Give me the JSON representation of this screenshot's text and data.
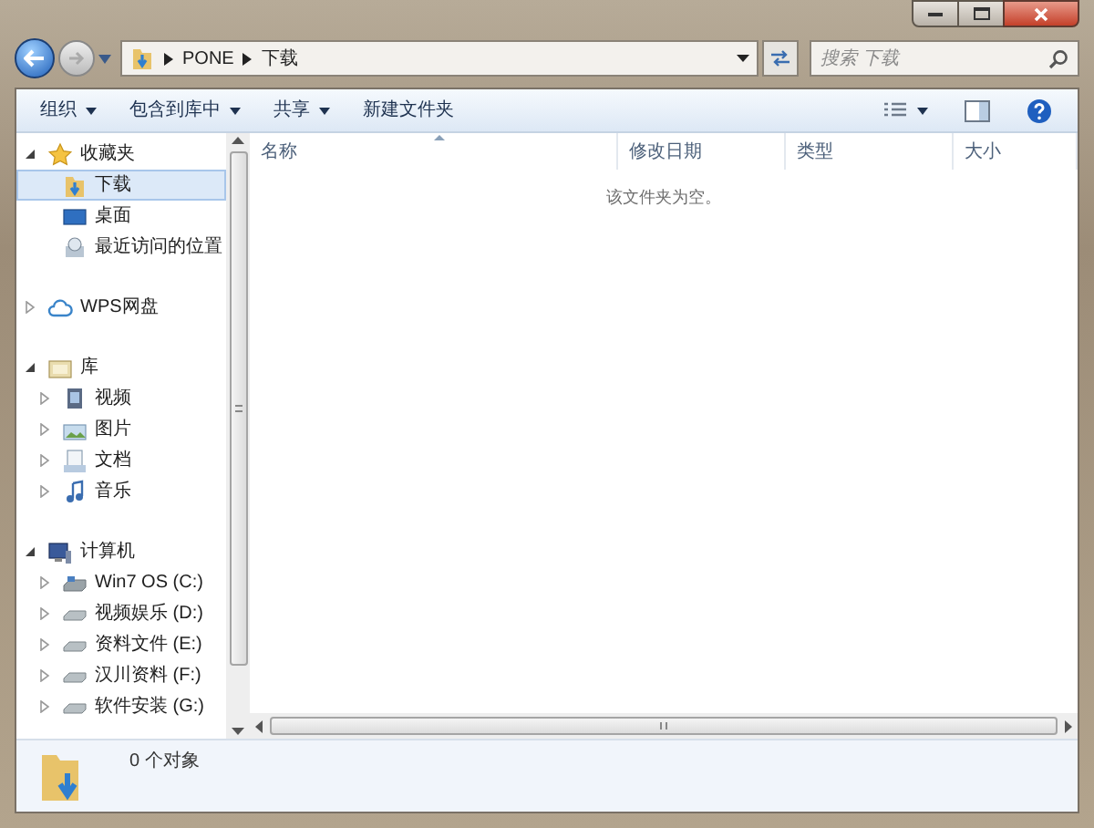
{
  "address_bar": {
    "breadcrumbs": [
      "PONE",
      "下载"
    ]
  },
  "search": {
    "placeholder": "搜索 下载"
  },
  "toolbar": [
    {
      "label": "组织",
      "dropdown": true
    },
    {
      "label": "包含到库中",
      "dropdown": true
    },
    {
      "label": "共享",
      "dropdown": true
    },
    {
      "label": "新建文件夹",
      "dropdown": false
    }
  ],
  "nav_tree": [
    {
      "label": "收藏夹",
      "kind": "star",
      "expanded": true,
      "selected": false,
      "children": [
        {
          "label": "下载",
          "kind": "download",
          "selected": true
        },
        {
          "label": "桌面",
          "kind": "desktop",
          "selected": false
        },
        {
          "label": "最近访问的位置",
          "kind": "recent",
          "selected": false
        }
      ]
    },
    {
      "label": "WPS网盘",
      "kind": "cloud",
      "expanded": false,
      "selected": false
    },
    {
      "label": "库",
      "kind": "library",
      "expanded": true,
      "selected": false,
      "children": [
        {
          "label": "视频",
          "kind": "video",
          "expanded": false,
          "selected": false
        },
        {
          "label": "图片",
          "kind": "picture",
          "expanded": false,
          "selected": false
        },
        {
          "label": "文档",
          "kind": "document",
          "expanded": false,
          "selected": false
        },
        {
          "label": "音乐",
          "kind": "music",
          "expanded": false,
          "selected": false
        }
      ]
    },
    {
      "label": "计算机",
      "kind": "computer",
      "expanded": true,
      "selected": false,
      "children": [
        {
          "label": "Win7 OS (C:)",
          "kind": "system-drive",
          "expanded": false,
          "selected": false
        },
        {
          "label": "视频娱乐 (D:)",
          "kind": "drive",
          "expanded": false,
          "selected": false
        },
        {
          "label": "资料文件 (E:)",
          "kind": "drive",
          "expanded": false,
          "selected": false
        },
        {
          "label": "汉川资料 (F:)",
          "kind": "drive",
          "expanded": false,
          "selected": false
        },
        {
          "label": "软件安装 (G:)",
          "kind": "drive",
          "expanded": false,
          "selected": false
        }
      ]
    }
  ],
  "columns": [
    {
      "label": "名称",
      "sorted": true
    },
    {
      "label": "修改日期",
      "sorted": false
    },
    {
      "label": "类型",
      "sorted": false
    },
    {
      "label": "大小",
      "sorted": false
    }
  ],
  "empty_message": "该文件夹为空。",
  "status_bar": {
    "text": "0 个对象"
  }
}
